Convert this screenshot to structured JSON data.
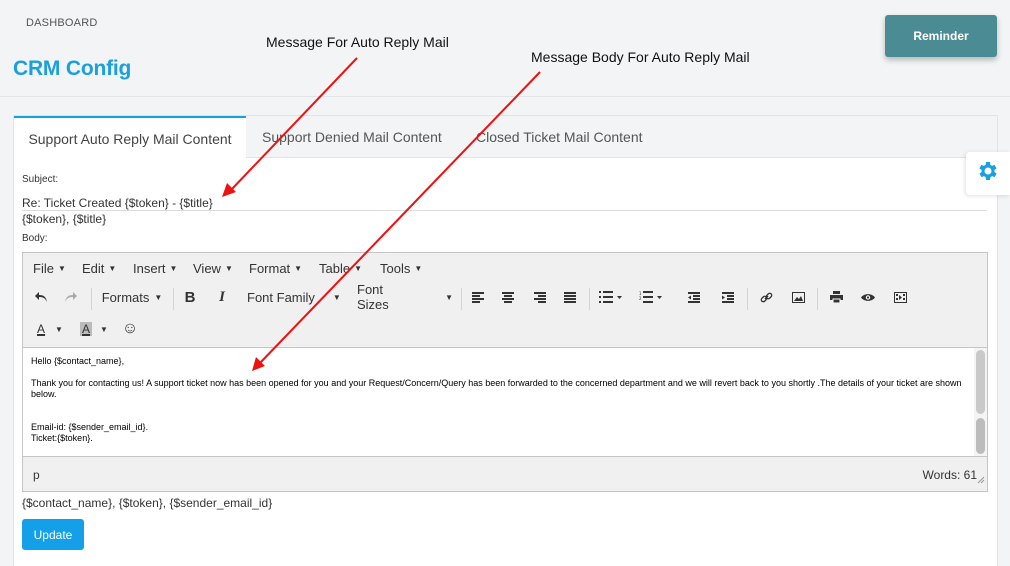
{
  "header": {
    "breadcrumb": "DASHBOARD",
    "title": "CRM Config",
    "reminder_label": "Reminder"
  },
  "tabs": [
    {
      "label": "Support Auto Reply Mail Content",
      "active": true
    },
    {
      "label": "Support Denied Mail Content",
      "active": false
    },
    {
      "label": "Closed Ticket Mail Content",
      "active": false
    }
  ],
  "form": {
    "subject_label": "Subject:",
    "subject_value": "Re: Ticket Created {$token} - {$title}",
    "subject_hint": "{$token}, {$title}",
    "body_label": "Body:",
    "body_hint": "{$contact_name}, {$token}, {$sender_email_id}",
    "update_label": "Update"
  },
  "editor": {
    "menus": [
      "File",
      "Edit",
      "Insert",
      "View",
      "Format",
      "Table",
      "Tools"
    ],
    "formats_label": "Formats",
    "font_family_label": "Font Family",
    "font_sizes_label": "Font Sizes",
    "content": {
      "greeting": "Hello {$contact_name},",
      "paragraph": "Thank you for contacting us! A support ticket now has been opened for you and your Request/Concern/Query has been forwarded to the concerned department and we will revert back to you shortly .The details of your ticket are shown below.",
      "email_line": "Email-id: {$sender_email_id}.",
      "ticket_line": "Ticket:{$token}."
    },
    "path": "p",
    "word_count": "Words: 61"
  },
  "annotations": {
    "subject_note": "Message For Auto Reply Mail",
    "body_note": "Message Body For Auto Reply Mail"
  },
  "colors": {
    "accent": "#1a9fe0",
    "reminder": "#4b8b93",
    "update": "#14a0e8",
    "arrow": "#ee1111"
  }
}
